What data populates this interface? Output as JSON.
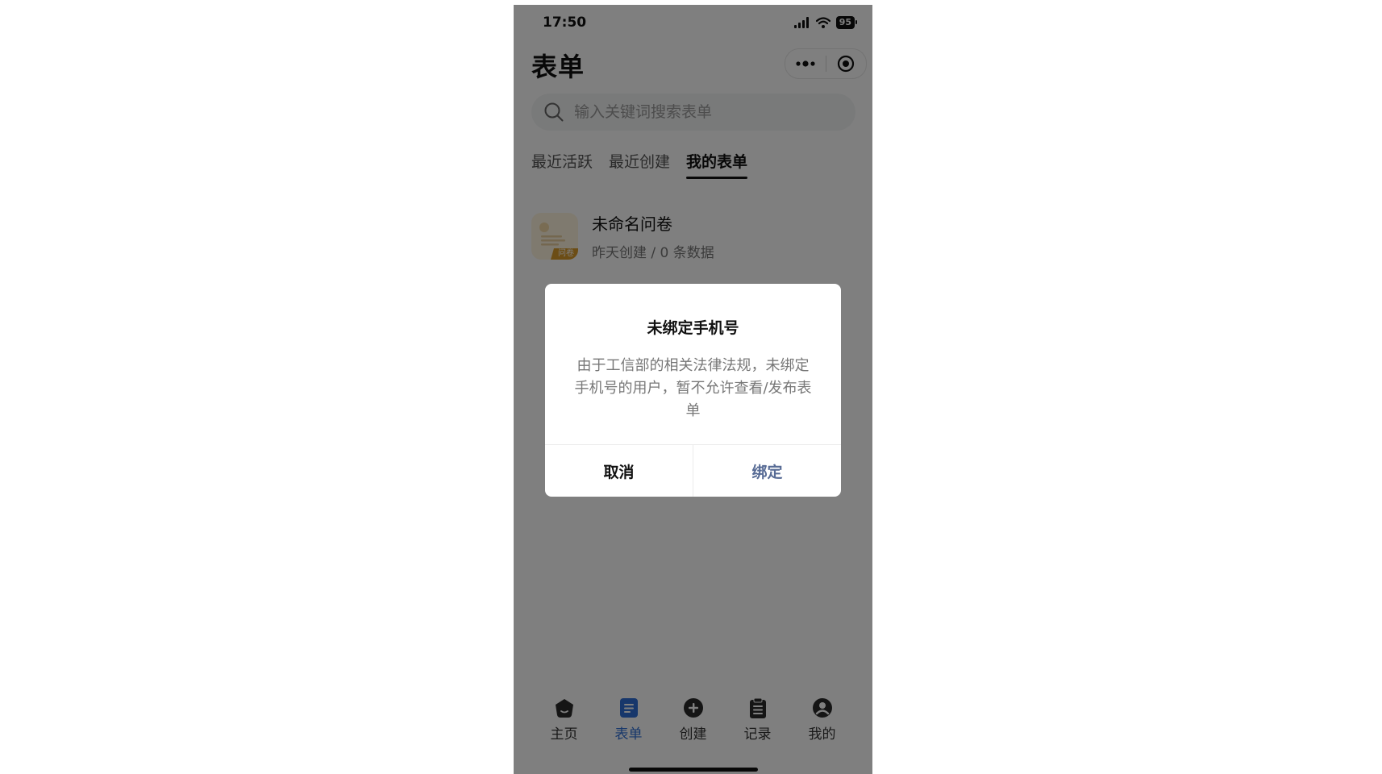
{
  "status_bar": {
    "time": "17:50",
    "battery": "95"
  },
  "header": {
    "title": "表单"
  },
  "search": {
    "placeholder": "输入关键词搜索表单"
  },
  "tabs": [
    {
      "label": "最近活跃",
      "active": false
    },
    {
      "label": "最近创建",
      "active": false
    },
    {
      "label": "我的表单",
      "active": true
    }
  ],
  "forms": [
    {
      "name": "未命名问卷",
      "meta": "昨天创建 / 0 条数据",
      "tag": "问卷"
    }
  ],
  "dialog": {
    "title": "未绑定手机号",
    "message": "由于工信部的相关法律法规，未绑定手机号的用户，暂不允许查看/发布表单",
    "cancel_label": "取消",
    "confirm_label": "绑定"
  },
  "tabbar": {
    "items": [
      {
        "label": "主页",
        "icon": "home-icon",
        "active": false
      },
      {
        "label": "表单",
        "icon": "form-icon",
        "active": true
      },
      {
        "label": "创建",
        "icon": "plus-circle-icon",
        "active": false
      },
      {
        "label": "记录",
        "icon": "clipboard-icon",
        "active": false
      },
      {
        "label": "我的",
        "icon": "user-icon",
        "active": false
      }
    ]
  },
  "colors": {
    "accent": "#2f6fd6",
    "dialog_confirm": "#576b95",
    "mask": "rgba(0,0,0,0.5)"
  }
}
